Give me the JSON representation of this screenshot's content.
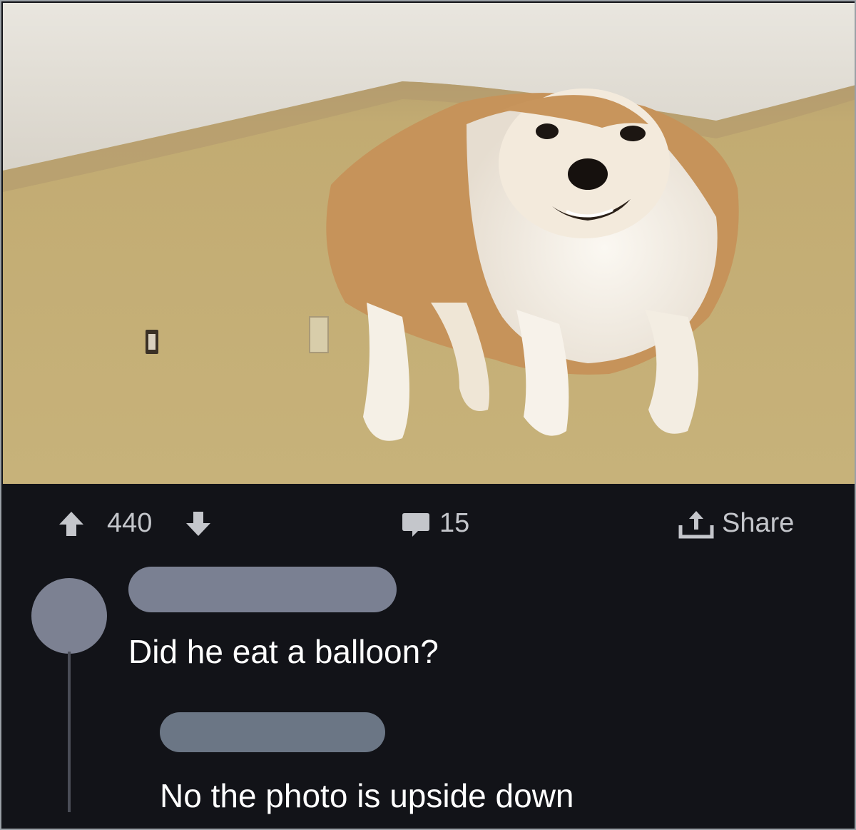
{
  "post": {
    "image_alt": "upside-down dog photo",
    "upvote_count": "440",
    "comment_count": "15",
    "share_label": "Share",
    "icons": [
      "upvote-arrow-icon",
      "downvote-arrow-icon",
      "comment-bubble-icon",
      "share-icon"
    ]
  },
  "comments": [
    {
      "text": "Did he eat a balloon?"
    },
    {
      "text": "No the photo is upside down"
    }
  ],
  "colors": {
    "background": "#121318",
    "icon_gray": "#c4c6cb",
    "avatar": "#7c8192",
    "username_redacted": "#7a8092",
    "reply_username_redacted": "#6b7685"
  }
}
